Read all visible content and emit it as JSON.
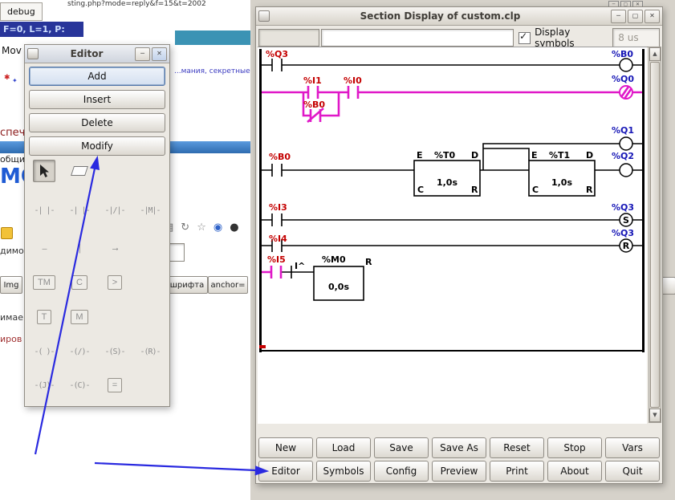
{
  "icons": {
    "minimize": "─",
    "maximize": "▢",
    "close": "✕",
    "check": "✓",
    "scroll_up": "▲",
    "scroll_down": "▼"
  },
  "background": {
    "tab_label": "debug",
    "url_fragment": "sting.php?mode=reply&f=15&t=2002",
    "status_bar": "F=0, L=1, P:",
    "mov": "Mov",
    "mark1": "✱",
    "mark2": "✦",
    "blue_link": "...мания, секретные",
    "heading_fragment": "спечь",
    "word_obshchi": "общи",
    "big_heading": "МО",
    "word_dimo": "димо",
    "img_button": "Img",
    "font_button": "шрифта",
    "anchor_button": "anchor=",
    "word_imae": "имае",
    "word_irov": "иров",
    "toolbar_icons": [
      "▤",
      "↻",
      "☆",
      "◉",
      "●"
    ]
  },
  "editor_window": {
    "title": "Editor",
    "buttons": [
      "Add",
      "Insert",
      "Delete",
      "Modify"
    ],
    "palette": {
      "contacts": [
        "-| |-",
        "-| |-",
        "-|/|-",
        "-|M|-"
      ],
      "wires": [
        "—",
        "│",
        "⟶"
      ],
      "blocks_row1": [
        "TM",
        "C",
        ">"
      ],
      "blocks_row2": [
        "T",
        "M"
      ],
      "coils_row1": [
        "-( )-",
        "-(/)-",
        "-(S)-",
        "-(R)-"
      ],
      "coils_row2": [
        "-(J)-",
        "-(C)-",
        "="
      ]
    }
  },
  "main_window": {
    "title": "Section Display of custom.clp",
    "display_symbols": "Display symbols",
    "scan_time": "8 us",
    "ladder": {
      "q3_top": "%Q3",
      "b0_top": "%B0",
      "i1": "%I1",
      "i0": "%I0",
      "q0": "%Q0",
      "b0_nc": "%B0",
      "q1": "%Q1",
      "b0_in": "%B0",
      "q2": "%Q2",
      "t0_name": "%T0",
      "t0_value": "1,0s",
      "t1_name": "%T1",
      "t1_value": "1,0s",
      "pin_e": "E",
      "pin_d": "D",
      "pin_c": "C",
      "pin_r": "R",
      "i3": "%I3",
      "q3_s": "%Q3",
      "coil_s": "S",
      "i4": "%I4",
      "q3_r": "%Q3",
      "coil_r": "R",
      "i5": "%I5",
      "edge": "I^",
      "m0_name": "%M0",
      "m0_value": "0,0s"
    },
    "buttons_row1": [
      "New",
      "Load",
      "Save",
      "Save As",
      "Reset",
      "Stop",
      "Vars"
    ],
    "buttons_row2": [
      "Editor",
      "Symbols",
      "Config",
      "Preview",
      "Print",
      "About",
      "Quit"
    ]
  },
  "colors": {
    "active_wire": "#e018c8",
    "input_label": "#c40000",
    "output_label": "#1616b6",
    "annotation_arrow": "#2a2ae0"
  }
}
